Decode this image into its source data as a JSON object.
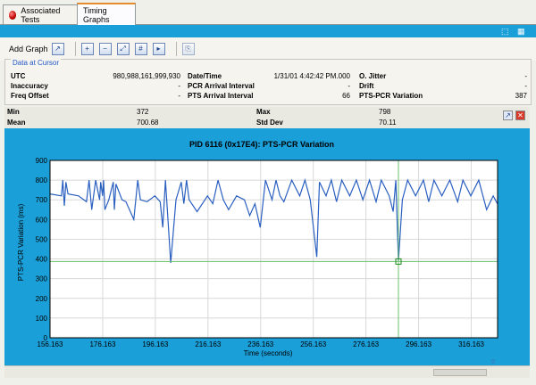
{
  "tabs": [
    {
      "label": "Associated Tests"
    },
    {
      "label": "Timing Graphs"
    }
  ],
  "toolbar": {
    "add_graph_label": "Add Graph"
  },
  "cursor": {
    "legend": "Data at Cursor",
    "utc_label": "UTC",
    "utc_value": "980,988,161,999,930",
    "datetime_label": "Date/Time",
    "datetime_value": "1/31/01 4:42:42 PM.000",
    "ojitter_label": "O. Jitter",
    "ojitter_value": "-",
    "inaccuracy_label": "Inaccuracy",
    "inaccuracy_value": "-",
    "pcr_arrival_label": "PCR Arrival Interval",
    "pcr_arrival_value": "-",
    "drift_label": "Drift",
    "drift_value": "-",
    "freq_label": "Freq Offset",
    "freq_value": "-",
    "pts_arrival_label": "PTS Arrival Interval",
    "pts_arrival_value": "66",
    "pts_pcr_label": "PTS-PCR Variation",
    "pts_pcr_value": "387"
  },
  "stats": {
    "min_label": "Min",
    "min_value": "372",
    "max_label": "Max",
    "max_value": "798",
    "mean_label": "Mean",
    "mean_value": "700.68",
    "std_label": "Std Dev",
    "std_value": "70.11"
  },
  "scroll": {
    "marker": "0"
  },
  "chart_data": {
    "type": "line",
    "title": "PID 6116 (0x17E4): PTS-PCR Variation",
    "xlabel": "Time (seconds)",
    "ylabel": "PTS-PCR Variation (ms)",
    "xlim": [
      156.163,
      326.163
    ],
    "ylim": [
      0,
      900
    ],
    "xticks": [
      "156.163",
      "176.163",
      "196.163",
      "216.163",
      "236.163",
      "256.163",
      "276.163",
      "296.163",
      "316.163"
    ],
    "yticks": [
      "0",
      "100",
      "200",
      "300",
      "400",
      "500",
      "600",
      "700",
      "800",
      "900"
    ],
    "grid": true,
    "line_color": "#2a5fc0",
    "cursor": {
      "x": 288.5,
      "y": 387
    },
    "series": [
      {
        "x": [
          156.2,
          160.5,
          161.0,
          161.6,
          162.2,
          163.0,
          167.0,
          170.0,
          171.0,
          172.0,
          173.5,
          175.0,
          175.4,
          176.1,
          176.5,
          177.0,
          178.5,
          180.2,
          180.6,
          181.2,
          183.5,
          185.0,
          188.0,
          189.5,
          190.5,
          193.0,
          196.0,
          198.0,
          199.0,
          200.0,
          202.0,
          204.0,
          206.0,
          207.0,
          208.0,
          209.0,
          212.0,
          216.0,
          218.0,
          220.0,
          222.0,
          224.0,
          227.0,
          230.0,
          232.0,
          234.0,
          236.0,
          238.0,
          240.5,
          242.0,
          243.5,
          245.0,
          248.0,
          251.0,
          253.0,
          255.0,
          257.5,
          258.5,
          261.0,
          263.0,
          265.0,
          267.0,
          270.0,
          272.5,
          275.0,
          277.5,
          280.0,
          282.0,
          285.0,
          286.5,
          287.5,
          288.5,
          290.0,
          292.0,
          295.0,
          298.0,
          300.0,
          302.0,
          305.0,
          308.0,
          311.0,
          313.0,
          316.0,
          319.0,
          322.0,
          324.5,
          326.1
        ],
        "y": [
          730,
          720,
          800,
          670,
          790,
          730,
          720,
          690,
          800,
          650,
          800,
          700,
          790,
          720,
          800,
          650,
          700,
          790,
          650,
          780,
          700,
          690,
          600,
          800,
          700,
          690,
          720,
          690,
          560,
          800,
          380,
          700,
          790,
          680,
          800,
          700,
          640,
          720,
          680,
          800,
          700,
          650,
          720,
          700,
          620,
          680,
          560,
          800,
          700,
          800,
          720,
          690,
          800,
          720,
          800,
          700,
          410,
          790,
          720,
          800,
          690,
          800,
          720,
          800,
          700,
          800,
          690,
          800,
          720,
          640,
          800,
          387,
          700,
          800,
          720,
          800,
          690,
          800,
          720,
          800,
          690,
          800,
          720,
          800,
          650,
          720,
          680
        ]
      }
    ]
  }
}
